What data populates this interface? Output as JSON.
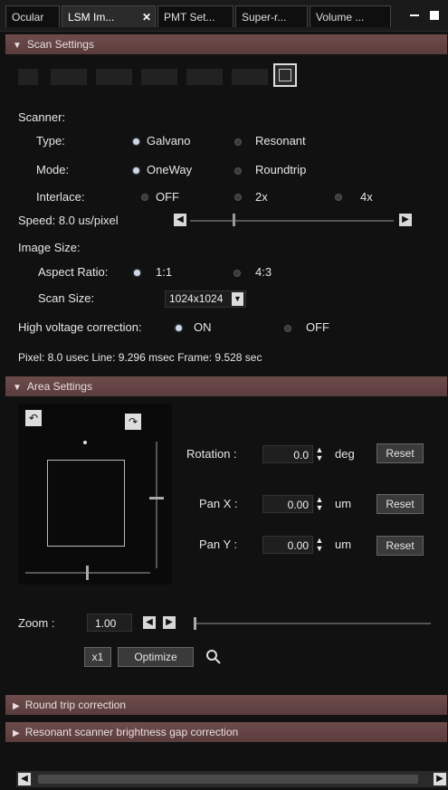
{
  "tabs": [
    {
      "label": "Ocular"
    },
    {
      "label": "LSM Im..."
    },
    {
      "label": "PMT Set..."
    },
    {
      "label": "Super-r..."
    },
    {
      "label": "Volume ..."
    }
  ],
  "tab_close_glyph": "✕",
  "sections": {
    "scan_settings": "Scan Settings",
    "area_settings": "Area Settings",
    "round_trip": "Round trip correction",
    "resonant_gap": "Resonant scanner brightness gap correction"
  },
  "scanner": {
    "label": "Scanner:",
    "type_label": "Type:",
    "type_options": [
      "Galvano",
      "Resonant"
    ],
    "mode_label": "Mode:",
    "mode_options": [
      "OneWay",
      "Roundtrip"
    ],
    "interlace_label": "Interlace:",
    "interlace_options": [
      "OFF",
      "2x",
      "4x"
    ]
  },
  "speed": {
    "label": "Speed: 8.0 us/pixel"
  },
  "image_size": {
    "label": "Image Size:",
    "aspect_label": "Aspect Ratio:",
    "aspect_options": [
      "1:1",
      "4:3"
    ],
    "scan_size_label": "Scan Size:",
    "scan_size_value": "1024x1024"
  },
  "hv": {
    "label": "High voltage correction:",
    "options": [
      "ON",
      "OFF"
    ]
  },
  "timing": "Pixel: 8.0 usec Line: 9.296 msec Frame: 9.528 sec",
  "area": {
    "rotation_label": "Rotation :",
    "rotation_value": "0.0",
    "rotation_unit": "deg",
    "pan_x_label": "Pan  X :",
    "pan_x_value": "0.00",
    "pan_y_label": "Pan  Y :",
    "pan_y_value": "0.00",
    "pan_unit": "um",
    "reset_label": "Reset",
    "zoom_label": "Zoom :",
    "zoom_value": "1.00",
    "x1_label": "x1",
    "optimize_label": "Optimize"
  },
  "colors": {
    "section_header": "#6e4c4c",
    "background": "#111111",
    "accent_radio": "#cfd6e6"
  }
}
